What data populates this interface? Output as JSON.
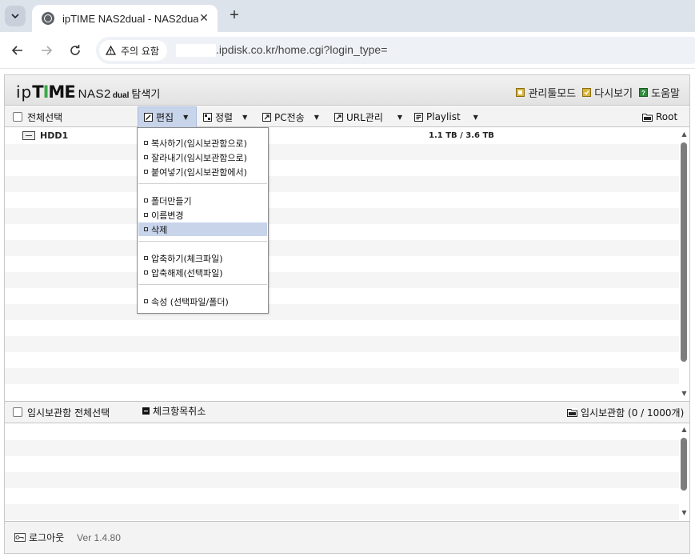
{
  "browser": {
    "tab_title": "ipTIME NAS2dual - NAS2dual",
    "security_label": "주의 요함",
    "url": ".ipdisk.co.kr/home.cgi?login_type="
  },
  "app": {
    "logo": {
      "ip": "ip",
      "time": "TIME",
      "nas": "NAS2",
      "dual": "dual",
      "explorer": "탐색기"
    },
    "header_links": [
      {
        "label": "관리툴모드",
        "icon": "admin-tool-icon",
        "color": "#c9a227"
      },
      {
        "label": "다시보기",
        "icon": "refresh-icon",
        "color": "#c9a227"
      },
      {
        "label": "도움말",
        "icon": "help-icon",
        "color": "#2e8b3a"
      }
    ],
    "menu": {
      "select_all": "전체선택",
      "edit": "편집",
      "sort": "정렬",
      "pc_transfer": "PC전송",
      "url_manage": "URL관리",
      "playlist": "Playlist",
      "root": "Root"
    },
    "files": [
      {
        "name": "HDD1",
        "size": "1.1 TB / 3.6 TB"
      }
    ],
    "edit_menu": [
      "복사하기(임시보관함으로)",
      "잘라내기(임시보관함으로)",
      "붙여넣기(임시보관함에서)",
      "폴더만들기",
      "이름변경",
      "삭제",
      "압축하기(체크파일)",
      "압축해제(선택파일)",
      "속성 (선택파일/폴더)"
    ],
    "temp": {
      "select_all": "임시보관함 전체선택",
      "uncheck": "체크항목취소",
      "count_label": "임시보관함 (0 / 1000개)"
    },
    "footer": {
      "logout": "로그아웃",
      "version": "Ver 1.4.80"
    }
  }
}
